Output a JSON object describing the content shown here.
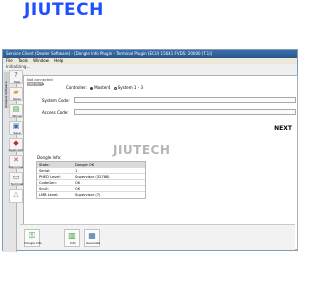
{
  "watermark_top": "JIUTECH",
  "watermark_center": "JIUTECH",
  "window": {
    "title": "Service Client (Dealer Software) - [Dongle Info Plugin - Terminal Plugin (ECU) 15641 FVDS: 20000 (T.1)]",
    "menu": [
      "File",
      "Tools",
      "Window",
      "Help"
    ],
    "status": "Initializing..."
  },
  "sidebar": {
    "tab_label": "Analysis Software",
    "tools": [
      {
        "label": "Help",
        "icon": "help-icon"
      },
      {
        "label": "Open",
        "icon": "open-folder-icon"
      },
      {
        "label": "Whole",
        "icon": "chart-icon"
      },
      {
        "label": "Save",
        "icon": "save-icon"
      },
      {
        "label": "Application",
        "icon": "application-icon"
      },
      {
        "label": "Disconnect",
        "icon": "disconnect-icon"
      },
      {
        "label": "Terminal",
        "icon": "terminal-icon"
      },
      {
        "label": "",
        "icon": "warning-icon"
      }
    ]
  },
  "content": {
    "connection_status": "Not connected",
    "tab": "Controllers",
    "next_label": "NEXT",
    "controller_label": "Controller:",
    "controller_options": [
      "Master4",
      "System 1 - 3"
    ],
    "system_code_label": "System Code:",
    "access_code_label": "Access Code:",
    "system_code_value": "",
    "access_code_value": ""
  },
  "dongle": {
    "title": "Dongle Info:",
    "rows": [
      {
        "key": "State:",
        "value": "Dongle OK"
      },
      {
        "key": "Serial:",
        "value": "1"
      },
      {
        "key": "PHED Level:",
        "value": "Supervisor (32768)"
      },
      {
        "key": "CodeGen:",
        "value": "OK"
      },
      {
        "key": "Scull:",
        "value": "OK"
      },
      {
        "key": "LMB Level:",
        "value": "Supervisor (7)"
      }
    ]
  },
  "bottom_buttons": [
    {
      "label": "Dongle Info",
      "icon": "dongle-icon"
    },
    {
      "label": "Info",
      "icon": "info-icon"
    },
    {
      "label": "Generate",
      "icon": "generate-icon"
    }
  ],
  "colors": {
    "brand": "#1f4fff",
    "highlight_row": "#dadada"
  }
}
